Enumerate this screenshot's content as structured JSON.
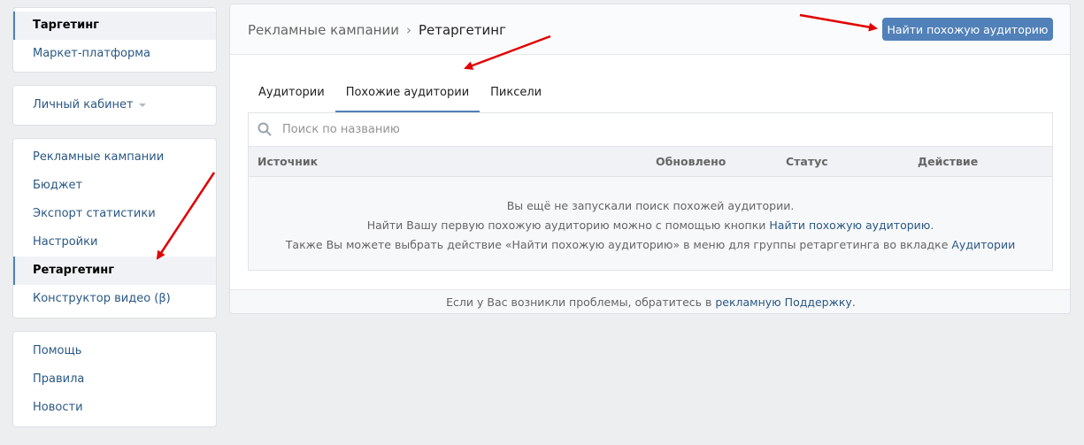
{
  "sidebar": {
    "top": [
      "Таргетинг",
      "Маркет-платформа"
    ],
    "cabinet": "Личный кабинет",
    "main": [
      "Рекламные кампании",
      "Бюджет",
      "Экспорт статистики",
      "Настройки",
      "Ретаргетинг",
      "Конструктор видео (β)"
    ],
    "help": [
      "Помощь",
      "Правила",
      "Новости"
    ]
  },
  "header": {
    "breadcrumb_parent": "Рекламные кампании",
    "breadcrumb_sep": "›",
    "breadcrumb_current": "Ретаргетинг",
    "find_button": "Найти похожую аудиторию"
  },
  "tabs": [
    "Аудитории",
    "Похожие аудитории",
    "Пиксели"
  ],
  "search": {
    "placeholder": "Поиск по названию"
  },
  "table": {
    "columns": [
      "Источник",
      "Обновлено",
      "Статус",
      "Действие"
    ],
    "empty_line1": "Вы ещё не запускали поиск похожей аудитории.",
    "empty_line2_pre": "Найти Вашу первую похожую аудиторию можно с помощью кнопки ",
    "empty_line2_link": "Найти похожую аудиторию",
    "empty_line2_post": ".",
    "empty_line3_pre": "Также Вы можете выбрать действие «Найти похожую аудиторию» в меню для группы ретаргетинга во вкладке ",
    "empty_line3_link": "Аудитории"
  },
  "footer": {
    "pre": "Если у Вас возникли проблемы, обратитесь в ",
    "link": "рекламную Поддержку",
    "post": "."
  },
  "colors": {
    "accent": "#5181b8",
    "link": "#2a5885",
    "annotation_arrow": "#e10000"
  }
}
